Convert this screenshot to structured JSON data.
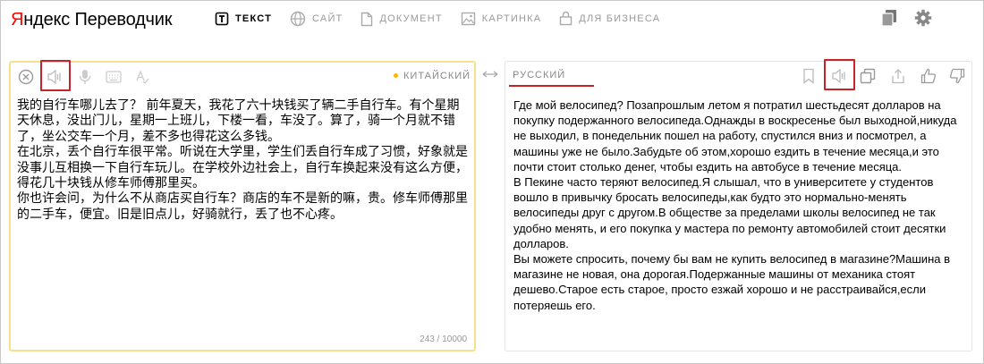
{
  "logo": {
    "brand_first": "Я",
    "brand_rest": "ндекс",
    "service": "Переводчик"
  },
  "nav": {
    "items": [
      {
        "label": "ТЕКСТ",
        "icon": "text-icon",
        "active": true
      },
      {
        "label": "САЙТ",
        "icon": "globe-icon",
        "active": false
      },
      {
        "label": "ДОКУМЕНТ",
        "icon": "document-icon",
        "active": false
      },
      {
        "label": "КАРТИНКА",
        "icon": "image-icon",
        "active": false
      },
      {
        "label": "ДЛЯ БИЗНЕСА",
        "icon": "briefcase-icon",
        "active": false
      }
    ]
  },
  "source": {
    "language": "КИТАЙСКИЙ",
    "text": "我的自行车哪儿去了？ 前年夏天，我花了六十块钱买了辆二手自行车。有个星期天休息，没出门儿，星期一上班儿，下楼一看，车没了。算了，骑一个月就不错了，坐公交车一个月，差不多也得花这么多钱。\n在北京，丢个自行车很平常。听说在大学里，学生们丢自行车成了习惯，好象就是没事儿互相换一下自行车玩儿。在学校外边社会上，自行车换起来没有这么方便，得花几十块钱从修车师傅那里买。\n你也许会问，为什么不从商店买自行车？商店的车不是新的嘛，贵。修车师傅那里的二手车，便宜。旧是旧点儿，好骑就行，丢了也不心疼。",
    "counter": "243 / 10000"
  },
  "target": {
    "language": "РУССКИЙ",
    "text": "Где мой велосипед? Позапрошлым летом я потратил шестьдесят долларов на покупку подержанного велосипеда.Однажды в воскресенье был выходной,никуда не выходил, в понедельник пошел на работу, спустился вниз и посмотрел, а машины уже не было.Забудьте об этом,хорошо ездить в течение месяца,и это почти стоит столько денег, чтобы ездить на автобусе в течение месяца.\nВ Пекине часто теряют велосипед.Я слышал, что в университете у студентов вошло в привычку бросать велосипеды,как будто это нормально-менять велосипеды друг с другом.В обществе за пределами школы велосипед не так удобно менять, и его покупка у мастера по ремонту автомобилей стоит десятки долларов.\nВы можете спросить, почему бы вам не купить велосипед в магазине?Машина в магазине не новая, она дорогая.Подержанные машины от механика стоят дешево.Старое есть старое, просто езжай хорошо и не расстраивайся,если потеряешь его."
  },
  "colors": {
    "accent_red": "#c7232a",
    "source_border": "#f7e08a",
    "lang_dot": "#ffb300"
  }
}
